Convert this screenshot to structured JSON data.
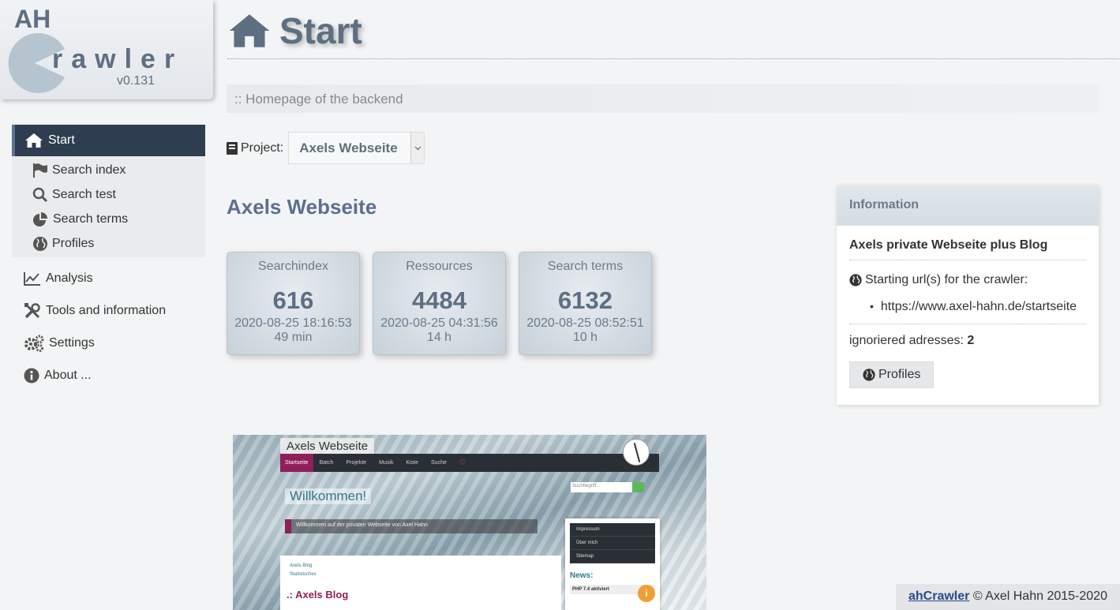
{
  "logo": {
    "ah": "AH",
    "crawler": "rawler",
    "version": "v0.131"
  },
  "nav": {
    "start": "Start",
    "sub": [
      "Search index",
      "Search test",
      "Search terms",
      "Profiles"
    ],
    "analysis": "Analysis",
    "tools": "Tools and information",
    "settings": "Settings",
    "about": "About ..."
  },
  "header": {
    "title": "Start",
    "subtitle": ":: Homepage of the backend"
  },
  "project": {
    "label": "Project:",
    "selected": "Axels Webseite"
  },
  "project_heading": "Axels Webseite",
  "tiles": [
    {
      "title": "Searchindex",
      "value": "616",
      "date": "2020-08-25 18:16:53",
      "age": "49 min"
    },
    {
      "title": "Ressources",
      "value": "4484",
      "date": "2020-08-25 04:31:56",
      "age": "14 h"
    },
    {
      "title": "Search terms",
      "value": "6132",
      "date": "2020-08-25 08:52:51",
      "age": "10 h"
    }
  ],
  "info": {
    "header": "Information",
    "name": "Axels private Webseite plus Blog",
    "start_label": "Starting url(s) for the crawler:",
    "urls": [
      "https://www.axel-hahn.de/startseite"
    ],
    "ignored_label": "ignoriered adresses:",
    "ignored_count": "2",
    "profiles_button": "Profiles"
  },
  "preview": {
    "title": "Axels Webseite",
    "nav": [
      "Startseite",
      "Batch",
      "Projekte",
      "Musik",
      "Kiste",
      "Suche"
    ],
    "search_placeholder": "Suchbegriff...",
    "welcome": "Willkommen!",
    "bar_text": "Willkommen auf der privaten Webseite von Axel Hahn",
    "menu": [
      "Impressum",
      "Über mich",
      "Sitemap"
    ],
    "news": "News:",
    "news_item": "PHP 7.4 aktiviert",
    "links": [
      "Axels Blog",
      "Statistisches"
    ],
    "blog": ".: Axels Blog"
  },
  "footer": {
    "link": "ahCrawler",
    "text": "© Axel Hahn 2015-2020"
  },
  "colors": {
    "nav_active": "#2e3d4f",
    "title": "#5e6f82",
    "accent": "#5d6f91"
  }
}
